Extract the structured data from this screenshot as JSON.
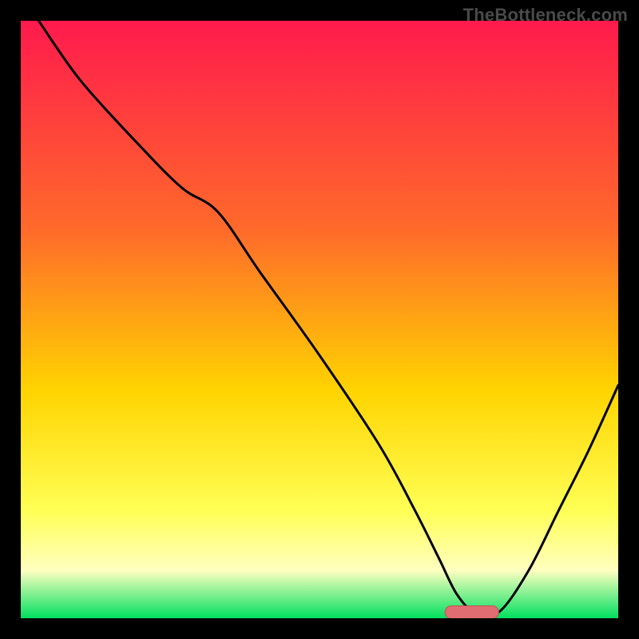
{
  "watermark": "TheBottleneck.com",
  "colors": {
    "frame": "#000000",
    "grad_top": "#ff1a4d",
    "grad_mid1": "#ff6a2a",
    "grad_mid2": "#ffd400",
    "grad_yellow": "#ffff55",
    "grad_pale": "#ffffc0",
    "grad_green": "#00e060",
    "curve": "#000000",
    "marker_fill": "#e06d72",
    "marker_stroke": "#c94f55"
  },
  "chart_data": {
    "type": "line",
    "title": "",
    "xlabel": "",
    "ylabel": "",
    "xlim": [
      0,
      100
    ],
    "ylim": [
      0,
      100
    ],
    "series": [
      {
        "name": "bottleneck-curve",
        "x": [
          3,
          10,
          20,
          27,
          33,
          40,
          50,
          60,
          66,
          70,
          73,
          76,
          80,
          85,
          90,
          95,
          100
        ],
        "y": [
          100,
          90,
          79,
          72,
          68,
          58,
          44,
          29,
          18,
          10,
          4,
          1,
          1,
          8,
          18,
          28,
          39
        ]
      }
    ],
    "marker": {
      "x_start": 71,
      "x_end": 80,
      "y": 1.0
    },
    "annotations": []
  }
}
